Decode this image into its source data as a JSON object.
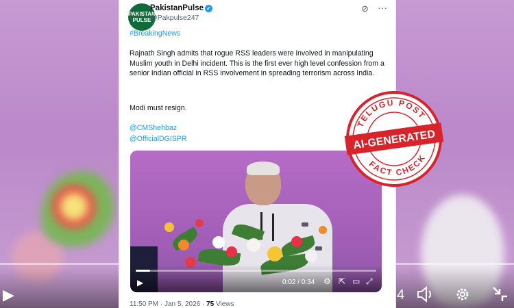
{
  "background": {
    "icons": [
      "play-icon",
      "volume-icon",
      "settings-gear-icon",
      "exit-fullscreen-icon"
    ],
    "time_fragment": "4"
  },
  "tweet": {
    "avatar_text": "PAKISTAN PULSE",
    "display_name": "PakistanPulse",
    "handle": "@Pakpulse247",
    "hashtag": "#BreakingNews",
    "body": "Rajnath Singh admits that rogue RSS leaders were involved in manipulating Muslim youth in Delhi incident. This is the first ever high level confession from a senior Indian official in RSS involvement in spreading terrorism across India.",
    "closing": "Modi must resign.",
    "mentions": [
      "@CMShehbaz",
      "@OfficialDGISPR"
    ],
    "timestamp": "11:50 PM · Jan 5, 2026 · ",
    "views_count": "75",
    "views_label": " Views"
  },
  "video": {
    "current_time": "0:02",
    "duration": "0:34",
    "time_display": "0:02 / 0:34",
    "progress": 0.06
  },
  "stamp": {
    "top_text": "TELUGU POST",
    "banner_text": "AI-GENERATED",
    "bottom_text": "FACT CHECK",
    "color": "#d8232a"
  },
  "colors": {
    "link": "#1d9bf0",
    "text": "#0f1419",
    "muted": "#536471"
  }
}
